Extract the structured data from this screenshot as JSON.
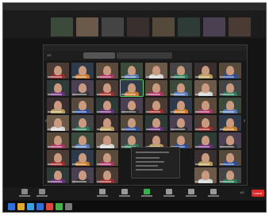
{
  "colors": {
    "window_bg": "#181818",
    "accent_green": "#5bd65b",
    "leave_red": "#e02828",
    "taskbar": "#0d0d0d"
  },
  "main": {
    "page_top": "1/2",
    "page_bottom": "1/2"
  },
  "toolbar": {
    "leave_label": "Leave"
  }
}
